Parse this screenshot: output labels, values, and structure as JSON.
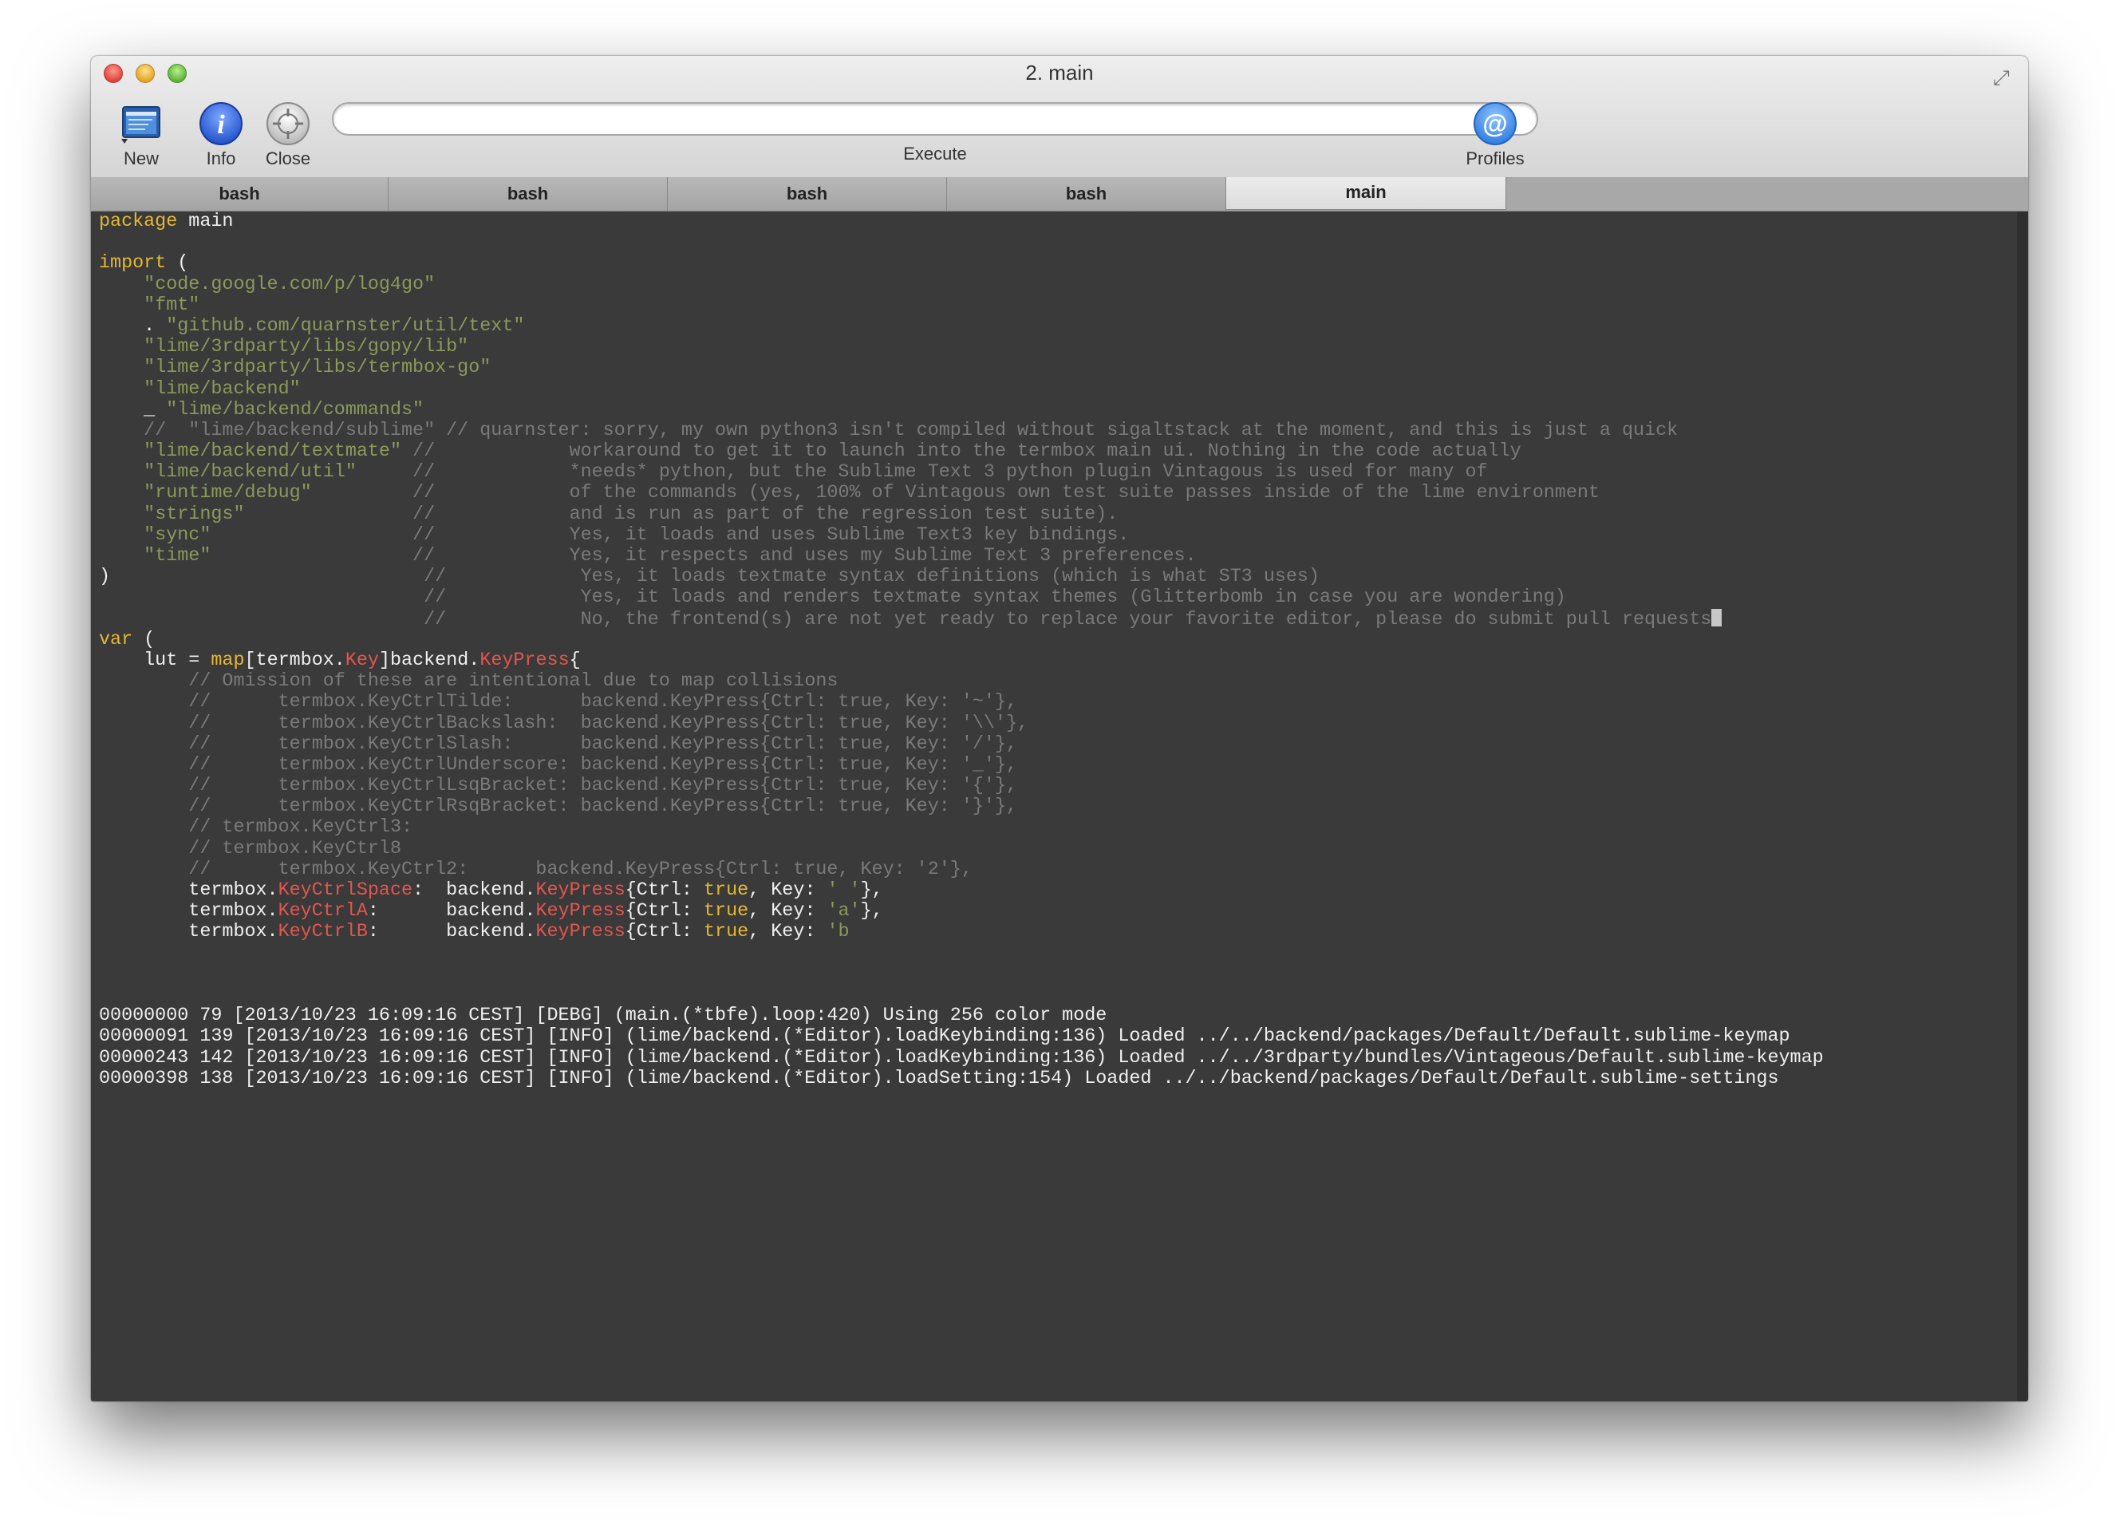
{
  "window": {
    "title": "2. main"
  },
  "toolbar": {
    "new_label": "New",
    "info_label": "Info",
    "close_label": "Close",
    "execute_label": "Execute",
    "execute_value": "",
    "profiles_label": "Profiles"
  },
  "tabs": [
    {
      "label": "bash",
      "active": false
    },
    {
      "label": "bash",
      "active": false
    },
    {
      "label": "bash",
      "active": false
    },
    {
      "label": "bash",
      "active": false
    },
    {
      "label": "main",
      "active": true
    }
  ],
  "colors": {
    "keyword": "#e5b833",
    "string": "#8a9a5b",
    "comment": "#7a7a7a",
    "type": "#e2564f",
    "text": "#f0f0f0",
    "background": "#3a3a3a"
  },
  "terminal": {
    "lines": [
      [
        [
          "kw",
          "package"
        ],
        [
          "t",
          " main"
        ]
      ],
      [],
      [
        [
          "kw",
          "import"
        ],
        [
          "t",
          " ("
        ]
      ],
      [
        [
          "t",
          "    "
        ],
        [
          "str",
          "\"code.google.com/p/log4go\""
        ]
      ],
      [
        [
          "t",
          "    "
        ],
        [
          "str",
          "\"fmt\""
        ]
      ],
      [
        [
          "t",
          "    . "
        ],
        [
          "str",
          "\"github.com/quarnster/util/text\""
        ]
      ],
      [
        [
          "t",
          "    "
        ],
        [
          "str",
          "\"lime/3rdparty/libs/gopy/lib\""
        ]
      ],
      [
        [
          "t",
          "    "
        ],
        [
          "str",
          "\"lime/3rdparty/libs/termbox-go\""
        ]
      ],
      [
        [
          "t",
          "    "
        ],
        [
          "str",
          "\"lime/backend\""
        ]
      ],
      [
        [
          "t",
          "    _ "
        ],
        [
          "str",
          "\"lime/backend/commands\""
        ]
      ],
      [
        [
          "t",
          "    "
        ],
        [
          "cm",
          "//  \"lime/backend/sublime\" // quarnster: sorry, my own python3 isn't compiled without sigaltstack at the moment, and this is just a quick"
        ]
      ],
      [
        [
          "t",
          "    "
        ],
        [
          "str",
          "\"lime/backend/textmate\""
        ],
        [
          "cm",
          " //            workaround to get it to launch into the termbox main ui. Nothing in the code actually"
        ]
      ],
      [
        [
          "t",
          "    "
        ],
        [
          "str",
          "\"lime/backend/util\""
        ],
        [
          "cm",
          "     //            *needs* python, but the Sublime Text 3 python plugin Vintagous is used for many of"
        ]
      ],
      [
        [
          "t",
          "    "
        ],
        [
          "str",
          "\"runtime/debug\""
        ],
        [
          "cm",
          "         //            of the commands (yes, 100% of Vintagous own test suite passes inside of the lime environment"
        ]
      ],
      [
        [
          "t",
          "    "
        ],
        [
          "str",
          "\"strings\""
        ],
        [
          "cm",
          "               //            and is run as part of the regression test suite)."
        ]
      ],
      [
        [
          "t",
          "    "
        ],
        [
          "str",
          "\"sync\""
        ],
        [
          "cm",
          "                  //            Yes, it loads and uses Sublime Text3 key bindings."
        ]
      ],
      [
        [
          "t",
          "    "
        ],
        [
          "str",
          "\"time\""
        ],
        [
          "cm",
          "                  //            Yes, it respects and uses my Sublime Text 3 preferences."
        ]
      ],
      [
        [
          "t",
          ")"
        ],
        [
          "cm",
          "                            //            Yes, it loads textmate syntax definitions (which is what ST3 uses)"
        ]
      ],
      [
        [
          "cm",
          "                             //            Yes, it loads and renders textmate syntax themes (Glitterbomb in case you are wondering)"
        ]
      ],
      [
        [
          "cm",
          "                             //            No, the frontend(s) are not yet ready to replace your favorite editor, please do submit pull requests"
        ],
        [
          "cursor",
          ""
        ]
      ],
      [
        [
          "kw",
          "var"
        ],
        [
          "t",
          " ("
        ]
      ],
      [
        [
          "t",
          "    lut = "
        ],
        [
          "kw",
          "map"
        ],
        [
          "t",
          "[termbox."
        ],
        [
          "ty",
          "Key"
        ],
        [
          "t",
          "]backend."
        ],
        [
          "ty",
          "KeyPress"
        ],
        [
          "t",
          "{"
        ]
      ],
      [
        [
          "t",
          "        "
        ],
        [
          "cm",
          "// Omission of these are intentional due to map collisions"
        ]
      ],
      [
        [
          "t",
          "        "
        ],
        [
          "cm",
          "//      termbox.KeyCtrlTilde:      backend.KeyPress{Ctrl: true, Key: '~'},"
        ]
      ],
      [
        [
          "t",
          "        "
        ],
        [
          "cm",
          "//      termbox.KeyCtrlBackslash:  backend.KeyPress{Ctrl: true, Key: '\\\\'},"
        ]
      ],
      [
        [
          "t",
          "        "
        ],
        [
          "cm",
          "//      termbox.KeyCtrlSlash:      backend.KeyPress{Ctrl: true, Key: '/'},"
        ]
      ],
      [
        [
          "t",
          "        "
        ],
        [
          "cm",
          "//      termbox.KeyCtrlUnderscore: backend.KeyPress{Ctrl: true, Key: '_'},"
        ]
      ],
      [
        [
          "t",
          "        "
        ],
        [
          "cm",
          "//      termbox.KeyCtrlLsqBracket: backend.KeyPress{Ctrl: true, Key: '{'},"
        ]
      ],
      [
        [
          "t",
          "        "
        ],
        [
          "cm",
          "//      termbox.KeyCtrlRsqBracket: backend.KeyPress{Ctrl: true, Key: '}'},"
        ]
      ],
      [
        [
          "t",
          "        "
        ],
        [
          "cm",
          "// termbox.KeyCtrl3:"
        ]
      ],
      [
        [
          "t",
          "        "
        ],
        [
          "cm",
          "// termbox.KeyCtrl8"
        ]
      ],
      [
        [
          "t",
          "        "
        ],
        [
          "cm",
          "//      termbox.KeyCtrl2:      backend.KeyPress{Ctrl: true, Key: '2'},"
        ]
      ],
      [
        [
          "t",
          "        termbox."
        ],
        [
          "ty",
          "KeyCtrlSpace"
        ],
        [
          "t",
          ":  backend."
        ],
        [
          "ty",
          "KeyPress"
        ],
        [
          "t",
          "{Ctrl: "
        ],
        [
          "bool",
          "true"
        ],
        [
          "t",
          ", Key: "
        ],
        [
          "str",
          "' '"
        ],
        [
          "t",
          "},"
        ]
      ],
      [
        [
          "t",
          "        termbox."
        ],
        [
          "ty",
          "KeyCtrlA"
        ],
        [
          "t",
          ":      backend."
        ],
        [
          "ty",
          "KeyPress"
        ],
        [
          "t",
          "{Ctrl: "
        ],
        [
          "bool",
          "true"
        ],
        [
          "t",
          ", Key: "
        ],
        [
          "str",
          "'a'"
        ],
        [
          "t",
          "},"
        ]
      ],
      [
        [
          "t",
          "        termbox."
        ],
        [
          "ty",
          "KeyCtrlB"
        ],
        [
          "t",
          ":      backend."
        ],
        [
          "ty",
          "KeyPress"
        ],
        [
          "t",
          "{Ctrl: "
        ],
        [
          "bool",
          "true"
        ],
        [
          "t",
          ", Key: "
        ],
        [
          "str",
          "'b"
        ]
      ],
      [],
      [],
      [],
      [
        [
          "t",
          "00000000 79 [2013/10/23 16:09:16 CEST] [DEBG] (main.(*tbfe).loop:420) Using 256 color mode"
        ]
      ],
      [
        [
          "t",
          "00000091 139 [2013/10/23 16:09:16 CEST] [INFO] (lime/backend.(*Editor).loadKeybinding:136) Loaded ../../backend/packages/Default/Default.sublime-keymap"
        ]
      ],
      [
        [
          "t",
          "00000243 142 [2013/10/23 16:09:16 CEST] [INFO] (lime/backend.(*Editor).loadKeybinding:136) Loaded ../../3rdparty/bundles/Vintageous/Default.sublime-keymap"
        ]
      ],
      [
        [
          "t",
          "00000398 138 [2013/10/23 16:09:16 CEST] [INFO] (lime/backend.(*Editor).loadSetting:154) Loaded ../../backend/packages/Default/Default.sublime-settings"
        ]
      ]
    ]
  }
}
